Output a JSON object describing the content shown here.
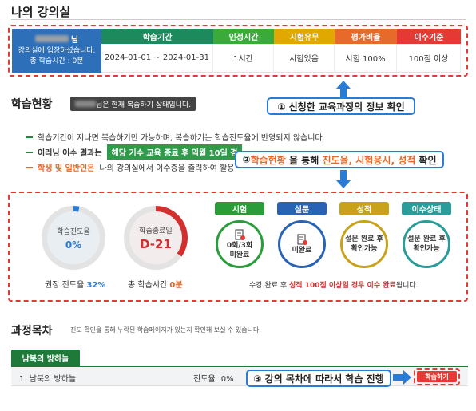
{
  "page_title": "나의 강의실",
  "course_info": {
    "name_suffix": "님",
    "welcome": "강의실에 입장하셨습니다.",
    "total_time": "총 학습시간 : 0분",
    "headers": [
      "학습기간",
      "인정시간",
      "시험유무",
      "평가비율",
      "이수기준"
    ],
    "values": [
      "2024-01-01 ~ 2024-01-31",
      "1시간",
      "시험있음",
      "시험 100%",
      "100점 이상"
    ],
    "header_colors": [
      "#1d8a5e",
      "#3aaa3a",
      "#e0a800",
      "#e86a2a",
      "#e53935"
    ]
  },
  "callout1": "① 신청한 교육과정의 정보 확인",
  "study_status": {
    "title": "학습현황",
    "status_suffix": "님은 현재 복습하기 상태입니다.",
    "bullets": [
      "학습기간이 지나면 복습하기만 가능하며, 복습하기는 학습진도율에 반영되지 않습니다.",
      "이러닝 이수 결과는",
      "해당 기수 교육 종료 후 익월 10일 경",
      "학생 및 일반인은",
      "나의 강의실에서 이수증을 출력하여 활용"
    ]
  },
  "callout2": {
    "prefix": "② ",
    "highlight1": "학습현황",
    "middle": " 을 통해 ",
    "highlight2": "진도율, 시험응시, 성적",
    "suffix": " 확인"
  },
  "stats": {
    "progress_label": "학습진도율",
    "progress_value": "0%",
    "recommended_label": "권장 진도율",
    "recommended_value": "32%",
    "end_label": "학습종료일",
    "end_value": "D-21",
    "total_label": "총 학습시간",
    "total_value": "0분",
    "cards": [
      {
        "badge": "시험",
        "color": "#2a9d3a",
        "line1": "0회/3회",
        "line2": "미완료",
        "icon": "exam-icon"
      },
      {
        "badge": "설문",
        "color": "#2a62b5",
        "line1": "",
        "line2": "미완료",
        "icon": "survey-icon"
      },
      {
        "badge": "성적",
        "color": "#c7a21a",
        "line1": "설문 완료 후",
        "line2": "확인가능",
        "icon": ""
      },
      {
        "badge": "이수상태",
        "color": "#2a9d9a",
        "line1": "설문 완료 후",
        "line2": "확인가능",
        "icon": ""
      }
    ],
    "note_prefix": "수강 완료 후 ",
    "note_highlight": "성적 100점 이상일 경우 이수 완료",
    "note_suffix": "됩니다."
  },
  "course_toc": {
    "title": "과정목차",
    "description": "진도 확인을 통해 누락된 학습페이지가 있는지 확인해 보실 수 있습니다.",
    "tab": "남북의 방하늘",
    "row_title": "1. 남북의 방하늘",
    "progress_label": "진도율",
    "progress_value": "0%",
    "study_button": "학습하기"
  },
  "callout3": "③ 강의 목차에 따라서 학습 진행"
}
